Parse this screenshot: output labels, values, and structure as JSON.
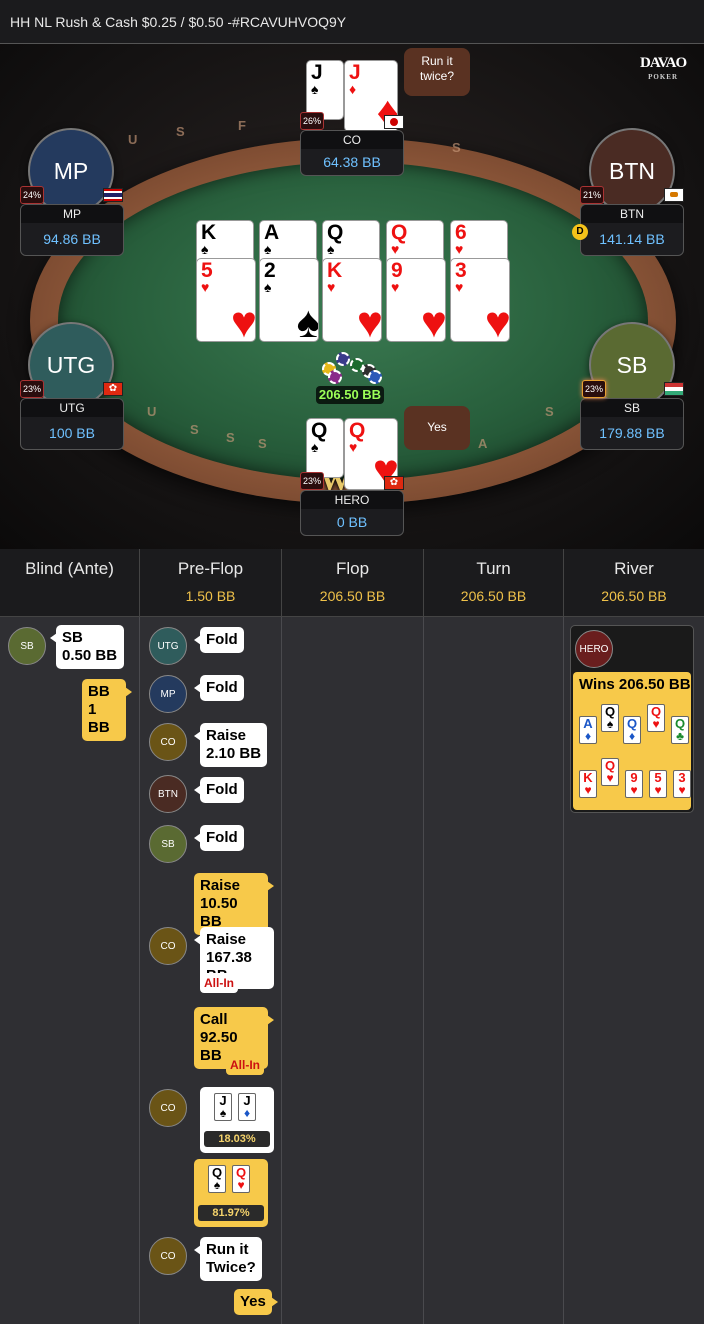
{
  "title": "HH NL Rush & Cash $0.25 / $0.50 -#RCAVUHVOQ9Y",
  "logo": {
    "main": "DAVAO",
    "sub": "POKER"
  },
  "rim_letters": [
    "U",
    "S",
    "F",
    "S",
    "S",
    "U",
    "S",
    "S",
    "S",
    "A"
  ],
  "seats": {
    "co": {
      "avatar": "",
      "name": "CO",
      "stack": "64.38 BB",
      "pct": "26%",
      "flag": "japan",
      "cards": [
        {
          "r": "J",
          "s": "♠"
        },
        {
          "r": "J",
          "s": "♦"
        }
      ],
      "bubble": "Run it twice?"
    },
    "mp": {
      "avatar": "MP",
      "name": "MP",
      "stack": "94.86 BB",
      "pct": "24%",
      "flag": "thailand"
    },
    "btn": {
      "avatar": "BTN",
      "name": "BTN",
      "stack": "141.14 BB",
      "pct": "21%",
      "flag": "cyprus"
    },
    "utg": {
      "avatar": "UTG",
      "name": "UTG",
      "stack": "100 BB",
      "pct": "23%",
      "flag": "hong-kong"
    },
    "sb": {
      "avatar": "SB",
      "name": "SB",
      "stack": "179.88 BB",
      "pct": "23%",
      "flag": "hungary"
    },
    "hero": {
      "name": "HERO",
      "stack": "0 BB",
      "pct": "23%",
      "flag": "hong-kong",
      "cards": [
        {
          "r": "Q",
          "s": "♠"
        },
        {
          "r": "Q",
          "s": "♥"
        }
      ],
      "bubble": "Yes",
      "badge": "WIN"
    }
  },
  "dealer_button": "D",
  "board": {
    "top": [
      {
        "r": "K",
        "s": "♠"
      },
      {
        "r": "A",
        "s": "♠"
      },
      {
        "r": "Q",
        "s": "♠"
      },
      {
        "r": "Q",
        "s": "♥"
      },
      {
        "r": "6",
        "s": "♥"
      }
    ],
    "bottom": [
      {
        "r": "5",
        "s": "♥"
      },
      {
        "r": "2",
        "s": "♠"
      },
      {
        "r": "K",
        "s": "♥"
      },
      {
        "r": "9",
        "s": "♥"
      },
      {
        "r": "3",
        "s": "♥"
      }
    ]
  },
  "pot": "206.50 BB",
  "columns": [
    {
      "title": "Blind (Ante)",
      "value": ""
    },
    {
      "title": "Pre-Flop",
      "value": "1.50 BB"
    },
    {
      "title": "Flop",
      "value": "206.50 BB"
    },
    {
      "title": "Turn",
      "value": "206.50 BB"
    },
    {
      "title": "River",
      "value": "206.50 BB"
    }
  ],
  "blind_actions": {
    "sb": {
      "pos": "SB",
      "text1": "SB",
      "text2": "0.50 BB"
    },
    "bb": {
      "text1": "BB",
      "text2": "1 BB"
    }
  },
  "preflop_actions": {
    "a1": {
      "pos": "UTG",
      "text": "Fold"
    },
    "a2": {
      "pos": "MP",
      "text": "Fold"
    },
    "a3": {
      "pos": "CO",
      "text1": "Raise",
      "text2": "2.10 BB"
    },
    "a4": {
      "pos": "BTN",
      "text": "Fold"
    },
    "a5": {
      "pos": "SB",
      "text": "Fold"
    },
    "a6": {
      "text1": "Raise",
      "text2": "10.50 BB"
    },
    "a7": {
      "pos": "CO",
      "text1": "Raise",
      "text2": "167.38 BB",
      "allin": "All-In"
    },
    "a8": {
      "text1": "Call",
      "text2": "92.50 BB",
      "allin": "All-In"
    },
    "a9": {
      "pos": "CO",
      "cards": [
        {
          "r": "J",
          "s": "♠"
        },
        {
          "r": "J",
          "s": "♦"
        }
      ],
      "equity": "18.03%"
    },
    "a10": {
      "cards": [
        {
          "r": "Q",
          "s": "♠"
        },
        {
          "r": "Q",
          "s": "♥"
        }
      ],
      "equity": "81.97%"
    },
    "a11": {
      "pos": "CO",
      "text1": "Run it",
      "text2": "Twice?"
    },
    "a12": {
      "text": "Yes"
    }
  },
  "river_result": {
    "pos": "HERO",
    "text": "Wins 206.50 BB",
    "row1": [
      {
        "r": "A",
        "s": "♦"
      },
      {
        "r": "Q",
        "s": "♠"
      },
      {
        "r": "Q",
        "s": "♦"
      },
      {
        "r": "Q",
        "s": "♥"
      },
      {
        "r": "Q",
        "s": "♣"
      }
    ],
    "row2": [
      {
        "r": "K",
        "s": "♥"
      },
      {
        "r": "Q",
        "s": "♥"
      },
      {
        "r": "9",
        "s": "♥"
      },
      {
        "r": "5",
        "s": "♥"
      },
      {
        "r": "3",
        "s": "♥"
      }
    ]
  },
  "colors": {
    "stack_blue": "#6fc1ff",
    "pot_green": "#9cff57",
    "accent_gold": "#f7c94a",
    "allin_red": "#cc1111",
    "felt_green": "#2f6b45",
    "rail_brown": "#8a5538"
  }
}
